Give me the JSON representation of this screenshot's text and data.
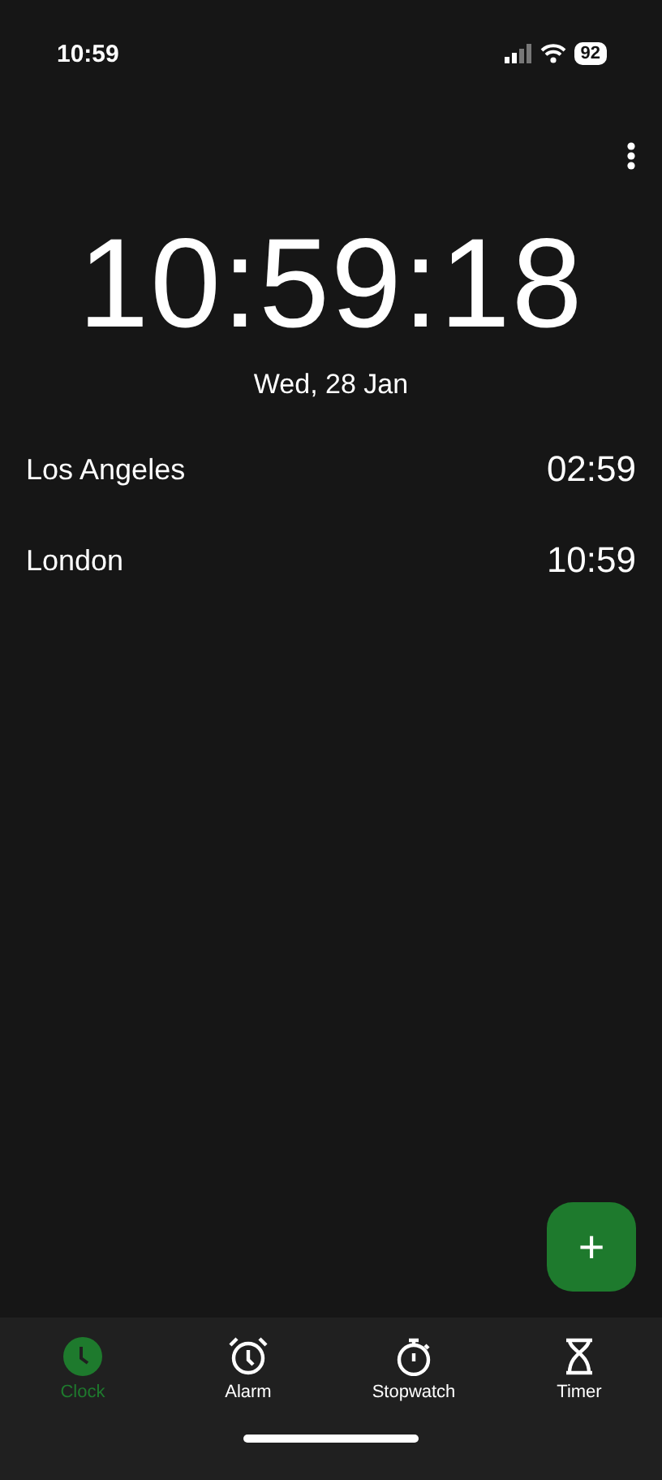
{
  "status_bar": {
    "time": "10:59",
    "battery": "92"
  },
  "clock": {
    "time": "10:59:18",
    "date": "Wed, 28 Jan"
  },
  "cities": [
    {
      "name": "Los Angeles",
      "time": "02:59"
    },
    {
      "name": "London",
      "time": "10:59"
    }
  ],
  "fab": {
    "label": "+"
  },
  "nav": [
    {
      "kind": "clock",
      "label": "Clock",
      "selected": true
    },
    {
      "kind": "alarm",
      "label": "Alarm",
      "selected": false
    },
    {
      "kind": "stopwatch",
      "label": "Stopwatch",
      "selected": false
    },
    {
      "kind": "timer",
      "label": "Timer",
      "selected": false
    }
  ]
}
